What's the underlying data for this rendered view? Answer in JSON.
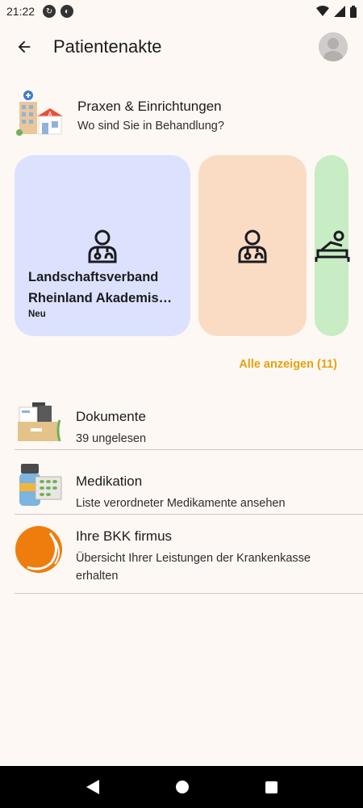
{
  "status": {
    "time": "21:22"
  },
  "header": {
    "title": "Patientenakte"
  },
  "praxen": {
    "title": "Praxen & Einrichtungen",
    "subtitle": "Wo sind Sie in Behandlung?"
  },
  "cards": [
    {
      "name_line1": "Landschaftsverband",
      "name_line2": "Rheinland Akademis…",
      "tag": "Neu",
      "color": "#dce2fd",
      "icon": "doctor-icon"
    },
    {
      "color": "#fadcc4",
      "icon": "doctor-icon"
    },
    {
      "color": "#c8ecc4",
      "icon": "massage-bed-icon"
    }
  ],
  "show_all": "Alle anzeigen (11)",
  "list": [
    {
      "title": "Dokumente",
      "subtitle": "39 ungelesen",
      "icon": "documents-box-icon"
    },
    {
      "title": "Medikation",
      "subtitle": "Liste verordneter Medikamente ansehen",
      "icon": "medication-icon"
    },
    {
      "title": "Ihre BKK firmus",
      "subtitle_line1": "Übersicht Ihrer Leistungen der Krankenkasse",
      "subtitle_line2": "erhalten",
      "icon": "bkk-logo-icon"
    }
  ],
  "colors": {
    "accent": "#e8a00c",
    "background": "#fdf8f4"
  }
}
